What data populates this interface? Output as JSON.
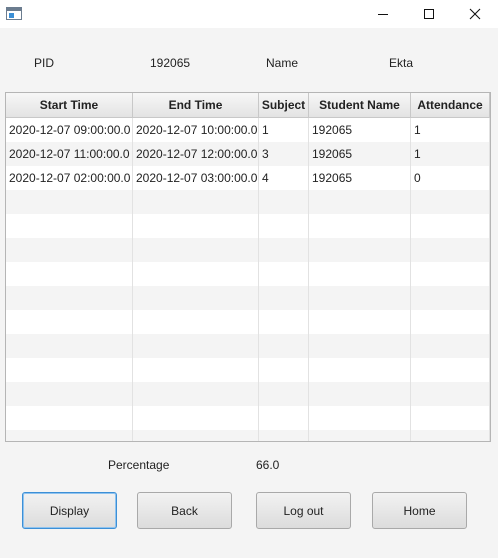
{
  "window": {
    "controls": [
      "minimize-icon",
      "maximize-icon",
      "close-icon"
    ]
  },
  "info": {
    "pid_label": "PID",
    "pid_value": "192065",
    "name_label": "Name",
    "name_value": "Ekta"
  },
  "table": {
    "columns": [
      "Start Time",
      "End Time",
      "Subject",
      "Student Name",
      "Attendance"
    ],
    "rows": [
      [
        "2020-12-07 09:00:00.0",
        "2020-12-07 10:00:00.0",
        "1",
        "192065",
        "1"
      ],
      [
        "2020-12-07 11:00:00.0",
        "2020-12-07 12:00:00.0",
        "3",
        "192065",
        "1"
      ],
      [
        "2020-12-07 02:00:00.0",
        "2020-12-07 03:00:00.0",
        "4",
        "192065",
        "0"
      ]
    ],
    "empty_row_count": 11
  },
  "summary": {
    "percentage_label": "Percentage",
    "percentage_value": "66.0"
  },
  "buttons": {
    "display": "Display",
    "back": "Back",
    "logout": "Log out",
    "home": "Home"
  },
  "colors": {
    "focus_border": "#3c8fd6",
    "window_bg": "#f4f4f4"
  }
}
